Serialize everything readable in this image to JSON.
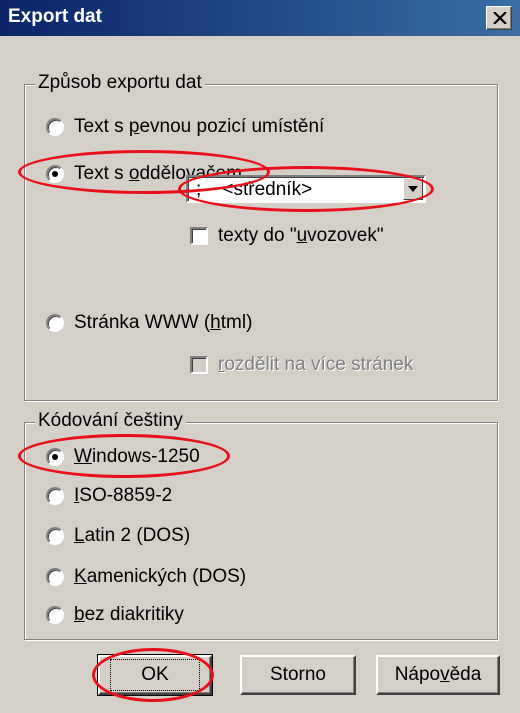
{
  "window": {
    "title": "Export dat"
  },
  "export_method": {
    "title": "Způsob exportu dat",
    "options": {
      "fixed": {
        "label": "Text s pevnou pozicí umístění",
        "selected": false
      },
      "delimited": {
        "label": "Text s oddělovačem",
        "selected": true
      },
      "www": {
        "label": "Stránka WWW (html)",
        "selected": false
      }
    },
    "separator": {
      "value": ";    <středník>"
    },
    "quote_texts": {
      "label": "texty do \"uvozovek\"",
      "checked": false
    },
    "split_pages": {
      "label": "rozdělit na více stránek",
      "checked": false,
      "enabled": false
    }
  },
  "encoding": {
    "title": "Kódování češtiny",
    "options": [
      {
        "label": "Windows-1250",
        "selected": true
      },
      {
        "label": "ISO-8859-2",
        "selected": false
      },
      {
        "label": "Latin 2 (DOS)",
        "selected": false
      },
      {
        "label": "Kamenických (DOS)",
        "selected": false
      },
      {
        "label": "bez diakritiky",
        "selected": false
      }
    ]
  },
  "buttons": {
    "ok": "OK",
    "cancel": "Storno",
    "help": "Nápověda"
  },
  "colors": {
    "titlebar_start": "#0a246a",
    "titlebar_end": "#3a6ea5",
    "highlight": "#e8101a",
    "face": "#d4d0c8"
  }
}
